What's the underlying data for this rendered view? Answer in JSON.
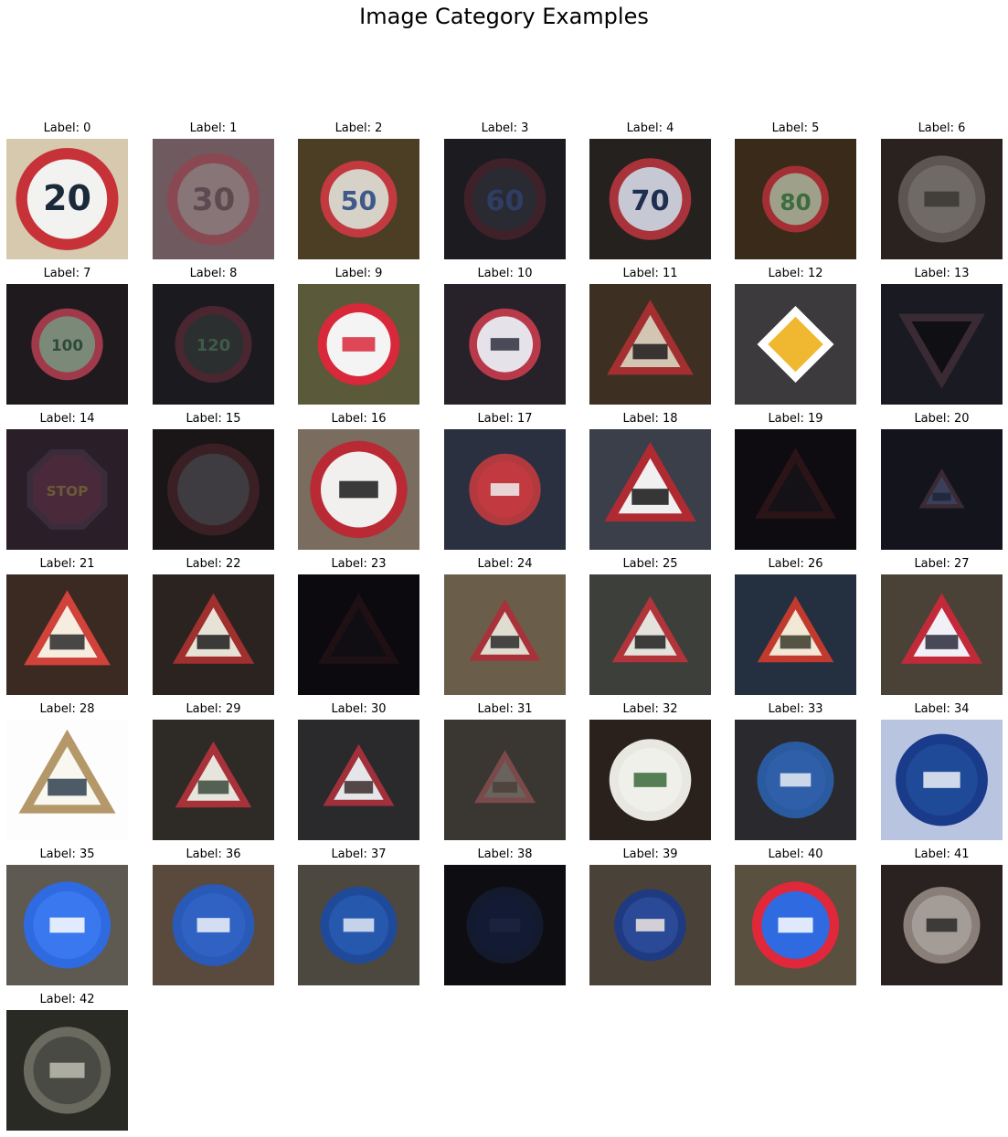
{
  "figure": {
    "title": "Image Category Examples"
  },
  "panels": [
    {
      "label": "Label: 0",
      "bg": "#d6c9ad",
      "shape": "circle",
      "rim": "#c63238",
      "face": "#f2f2f0",
      "sym": "#1b2a3a",
      "text": "20",
      "sign_scale": 1.0
    },
    {
      "label": "Label: 1",
      "bg": "#6e5a5f",
      "shape": "circle",
      "rim": "#8a4952",
      "face": "#877577",
      "sym": "#5b4a4f",
      "text": "30",
      "sign_scale": 0.9
    },
    {
      "label": "Label: 2",
      "bg": "#4b3e24",
      "shape": "circle",
      "rim": "#c23a3f",
      "face": "#d6d2c8",
      "sym": "#3f5a8a",
      "text": "50",
      "sign_scale": 0.75
    },
    {
      "label": "Label: 3",
      "bg": "#1c1b20",
      "shape": "circle",
      "rim": "#3f2229",
      "face": "#2a2a33",
      "sym": "#2f3d62",
      "text": "60",
      "sign_scale": 0.8
    },
    {
      "label": "Label: 4",
      "bg": "#25211f",
      "shape": "circle",
      "rim": "#a8333a",
      "face": "#c6c9d3",
      "sym": "#1f2f4f",
      "text": "70",
      "sign_scale": 0.8
    },
    {
      "label": "Label: 5",
      "bg": "#3a2a1a",
      "shape": "circle",
      "rim": "#a32f34",
      "face": "#9fa08a",
      "sym": "#3d6d3f",
      "text": "80",
      "sign_scale": 0.65
    },
    {
      "label": "Label: 6",
      "bg": "#2a221e",
      "shape": "circle",
      "rim": "#5c5552",
      "face": "#6f6a66",
      "sym": "#3b3633",
      "text": "",
      "sign_scale": 0.85
    },
    {
      "label": "Label: 7",
      "bg": "#1f1a1d",
      "shape": "circle",
      "rim": "#a03a4a",
      "face": "#7b8a78",
      "sym": "#2f4a3a",
      "text": "100",
      "sign_scale": 0.7
    },
    {
      "label": "Label: 8",
      "bg": "#1b1a1f",
      "shape": "circle",
      "rim": "#4a2630",
      "face": "#2c2f2f",
      "sym": "#3f5a4a",
      "text": "120",
      "sign_scale": 0.75
    },
    {
      "label": "Label: 9",
      "bg": "#5a5a3a",
      "shape": "circle",
      "rim": "#d8283a",
      "face": "#f4f4f4",
      "sym": "#d8283a",
      "text": "",
      "sign_scale": 0.8
    },
    {
      "label": "Label: 10",
      "bg": "#27212a",
      "shape": "circle",
      "rim": "#b83a4a",
      "face": "#e6e2ea",
      "sym": "#2f2f3f",
      "text": "",
      "sign_scale": 0.7
    },
    {
      "label": "Label: 11",
      "bg": "#3d2f21",
      "shape": "triangle",
      "rim": "#a32f31",
      "face": "#d2c6b2",
      "sym": "#1f1a1a",
      "text": "",
      "sign_scale": 0.85
    },
    {
      "label": "Label: 12",
      "bg": "#3c3a3c",
      "shape": "diamond",
      "rim": "#ffffff",
      "face": "#f0b830",
      "sym": "",
      "text": "",
      "sign_scale": 0.75
    },
    {
      "label": "Label: 13",
      "bg": "#1a1a22",
      "shape": "invtriangle",
      "rim": "#3a2a34",
      "face": "#0f0f14",
      "sym": "",
      "text": "",
      "sign_scale": 0.85
    },
    {
      "label": "Label: 14",
      "bg": "#2a1e28",
      "shape": "octagon",
      "rim": "#3a2c3a",
      "face": "#4a2a3a",
      "sym": "#6a5a3a",
      "text": "STOP",
      "sign_scale": 0.85
    },
    {
      "label": "Label: 15",
      "bg": "#1a1618",
      "shape": "circle",
      "rim": "#3a2025",
      "face": "#3e3c40",
      "sym": "",
      "text": "",
      "sign_scale": 0.9
    },
    {
      "label": "Label: 16",
      "bg": "#7a6c5e",
      "shape": "circle",
      "rim": "#b92a34",
      "face": "#f2f0ee",
      "sym": "#1a1a1a",
      "text": "",
      "sign_scale": 0.95
    },
    {
      "label": "Label: 17",
      "bg": "#2a3040",
      "shape": "circle",
      "rim": "#b23a3f",
      "face": "#c23a40",
      "sym": "#f0f0f0",
      "text": "",
      "sign_scale": 0.7
    },
    {
      "label": "Label: 18",
      "bg": "#3a3f4a",
      "shape": "triangle",
      "rim": "#b02a32",
      "face": "#f0f0f0",
      "sym": "#151515",
      "text": "",
      "sign_scale": 0.9
    },
    {
      "label": "Label: 19",
      "bg": "#0e0c10",
      "shape": "triangle",
      "rim": "#2a1418",
      "face": "#141216",
      "sym": "",
      "text": "",
      "sign_scale": 0.8
    },
    {
      "label": "Label: 20",
      "bg": "#14151c",
      "shape": "triangle",
      "rim": "#3a2a36",
      "face": "#3a3f5a",
      "sym": "#1f2438",
      "text": "",
      "sign_scale": 0.45
    },
    {
      "label": "Label: 21",
      "bg": "#3a2a22",
      "shape": "triangle",
      "rim": "#d0423a",
      "face": "#f7ece0",
      "sym": "#2a2a2a",
      "text": "",
      "sign_scale": 0.85
    },
    {
      "label": "Label: 22",
      "bg": "#2a2320",
      "shape": "triangle",
      "rim": "#a0302e",
      "face": "#e7e2d6",
      "sym": "#1c1c1c",
      "text": "",
      "sign_scale": 0.8
    },
    {
      "label": "Label: 23",
      "bg": "#0c0a0e",
      "shape": "triangle",
      "rim": "#1f1014",
      "face": "#100e12",
      "sym": "",
      "text": "",
      "sign_scale": 0.8
    },
    {
      "label": "Label: 24",
      "bg": "#6a5e4a",
      "shape": "triangle",
      "rim": "#a8323a",
      "face": "#e0dccf",
      "sym": "#2a2a2a",
      "text": "",
      "sign_scale": 0.7
    },
    {
      "label": "Label: 25",
      "bg": "#3c3f3a",
      "shape": "triangle",
      "rim": "#b0343a",
      "face": "#e4e2dc",
      "sym": "#1f1f1f",
      "text": "",
      "sign_scale": 0.75
    },
    {
      "label": "Label: 26",
      "bg": "#243040",
      "shape": "triangle",
      "rim": "#c23a2e",
      "face": "#f2e8d6",
      "sym": "#3a3a2a",
      "text": "",
      "sign_scale": 0.75
    },
    {
      "label": "Label: 27",
      "bg": "#4a4236",
      "shape": "triangle",
      "rim": "#c22a3a",
      "face": "#f0f0f6",
      "sym": "#2a2a3a",
      "text": "",
      "sign_scale": 0.8
    },
    {
      "label": "Label: 28",
      "bg": "#fdfdfd",
      "shape": "triangle",
      "rim": "#b5986a",
      "face": "#f8f8f0",
      "sym": "#2f3f4f",
      "text": "",
      "sign_scale": 0.95
    },
    {
      "label": "Label: 29",
      "bg": "#2e2a26",
      "shape": "triangle",
      "rim": "#a8323a",
      "face": "#e6e4dc",
      "sym": "#3a4a3a",
      "text": "",
      "sign_scale": 0.75
    },
    {
      "label": "Label: 30",
      "bg": "#2a2a2c",
      "shape": "triangle",
      "rim": "#a0303a",
      "face": "#e4e6ea",
      "sym": "#3a2a2a",
      "text": "",
      "sign_scale": 0.7
    },
    {
      "label": "Label: 31",
      "bg": "#3a3632",
      "shape": "triangle",
      "rim": "#7a4a4a",
      "face": "#6a625c",
      "sym": "#4a4038",
      "text": "",
      "sign_scale": 0.6
    },
    {
      "label": "Label: 32",
      "bg": "#2a201c",
      "shape": "circle",
      "rim": "#e8e8e0",
      "face": "#f0f0ea",
      "sym": "#3a6a3a",
      "text": "",
      "sign_scale": 0.8
    },
    {
      "label": "Label: 33",
      "bg": "#2a2a2e",
      "shape": "circle",
      "rim": "#2a5aa0",
      "face": "#2e5fa8",
      "sym": "#e8ecf4",
      "text": "",
      "sign_scale": 0.75
    },
    {
      "label": "Label: 34",
      "bg": "#b8c4e0",
      "shape": "circle",
      "rim": "#1a3a8a",
      "face": "#1f4a98",
      "sym": "#f0f2f8",
      "text": "",
      "sign_scale": 0.9
    },
    {
      "label": "Label: 35",
      "bg": "#5e5a52",
      "shape": "circle",
      "rim": "#2f6ae0",
      "face": "#3a78f0",
      "sym": "#ffffff",
      "text": "",
      "sign_scale": 0.85
    },
    {
      "label": "Label: 36",
      "bg": "#5a4a3e",
      "shape": "circle",
      "rim": "#2a5ab8",
      "face": "#2f62c2",
      "sym": "#f0f4fa",
      "text": "",
      "sign_scale": 0.8
    },
    {
      "label": "Label: 37",
      "bg": "#4c4840",
      "shape": "circle",
      "rim": "#1f4a9a",
      "face": "#2658ae",
      "sym": "#e0e8f4",
      "text": "",
      "sign_scale": 0.75
    },
    {
      "label": "Label: 38",
      "bg": "#0e0e12",
      "shape": "circle",
      "rim": "#141a2e",
      "face": "#131a33",
      "sym": "#1c2440",
      "text": "",
      "sign_scale": 0.75
    },
    {
      "label": "Label: 39",
      "bg": "#4a4238",
      "shape": "circle",
      "rim": "#1f3a80",
      "face": "#2a4a98",
      "sym": "#f0e8e0",
      "text": "",
      "sign_scale": 0.7
    },
    {
      "label": "Label: 40",
      "bg": "#5a5040",
      "shape": "circle",
      "rim": "#e0283a",
      "face": "#2f6ae0",
      "sym": "#ffffff",
      "text": "",
      "sign_scale": 0.85
    },
    {
      "label": "Label: 41",
      "bg": "#2a2220",
      "shape": "circle",
      "rim": "#8a7e78",
      "face": "#a49c96",
      "sym": "#2a2a2a",
      "text": "",
      "sign_scale": 0.75
    },
    {
      "label": "Label: 42",
      "bg": "#2a2a24",
      "shape": "circle",
      "rim": "#6a6a60",
      "face": "#4a4a44",
      "sym": "#bdbdb2",
      "text": "",
      "sign_scale": 0.85
    }
  ]
}
